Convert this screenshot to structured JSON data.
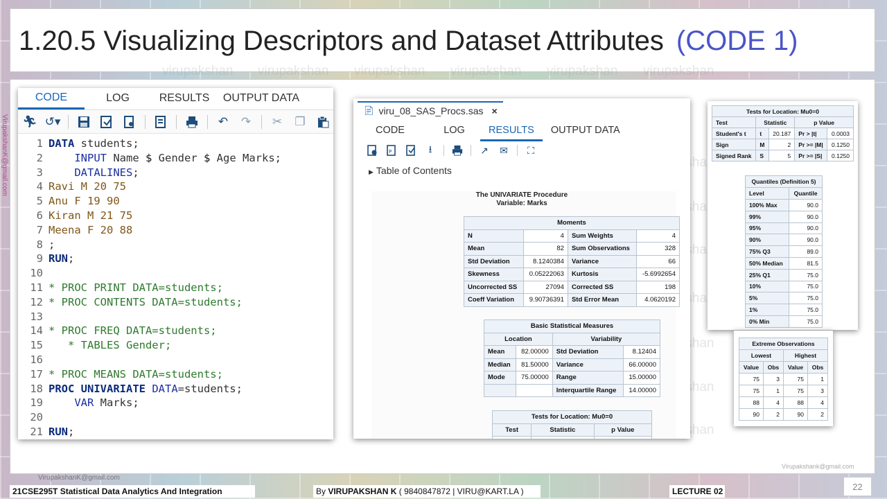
{
  "slide": {
    "title": "1.20.5 Visualizing Descriptors and Dataset Attributes",
    "title_code": "(CODE 1)",
    "watermark": "virupakshan",
    "side_email": "VirupakshanK@gmail.com",
    "footer_email_left": "VirupakshanK@gmail.com",
    "footer_email_right": "Virupakshank@gmail.com",
    "course": "21CSE295T Statistical Data Analytics And Integration",
    "author_prefix": "By ",
    "author_name": "VIRUPAKSHAN K",
    "author_contact": " ( 9840847872 | VIRU@KART.LA )",
    "lecture": "LECTURE 02",
    "page_number": "22",
    "accent_color": "#4a55c6"
  },
  "editor": {
    "tabs": [
      "CODE",
      "LOG",
      "RESULTS",
      "OUTPUT DATA"
    ],
    "active_tab": "CODE",
    "toolbar_icons": [
      "run-icon",
      "history-icon",
      "save-icon",
      "save-as-icon",
      "new-icon",
      "format-icon",
      "print-icon",
      "undo-icon",
      "redo-icon",
      "cut-icon",
      "copy-icon",
      "paste-icon"
    ],
    "lines": [
      {
        "n": "1",
        "parts": [
          [
            "kw",
            "DATA"
          ],
          [
            "tx",
            " students;"
          ]
        ]
      },
      {
        "n": "2",
        "parts": [
          [
            "tx",
            "    "
          ],
          [
            "kw2",
            "INPUT"
          ],
          [
            "tx",
            " Name "
          ],
          [
            "sym",
            "$"
          ],
          [
            "tx",
            " Gender "
          ],
          [
            "sym",
            "$"
          ],
          [
            "tx",
            " Age Marks;"
          ]
        ]
      },
      {
        "n": "3",
        "parts": [
          [
            "tx",
            "    "
          ],
          [
            "kw2",
            "DATALINES"
          ],
          [
            "tx",
            ";"
          ]
        ]
      },
      {
        "n": "4",
        "parts": [
          [
            "dl",
            "Ravi M 20 75"
          ]
        ]
      },
      {
        "n": "5",
        "parts": [
          [
            "dl",
            "Anu F 19 90"
          ]
        ]
      },
      {
        "n": "6",
        "parts": [
          [
            "dl",
            "Kiran M 21 75"
          ]
        ]
      },
      {
        "n": "7",
        "parts": [
          [
            "dl",
            "Meena F 20 88"
          ]
        ]
      },
      {
        "n": "8",
        "parts": [
          [
            "tx",
            ";"
          ]
        ]
      },
      {
        "n": "9",
        "parts": [
          [
            "kw",
            "RUN"
          ],
          [
            "tx",
            ";"
          ]
        ]
      },
      {
        "n": "10",
        "parts": []
      },
      {
        "n": "11",
        "parts": [
          [
            "cm",
            "* PROC PRINT DATA=students;"
          ]
        ]
      },
      {
        "n": "12",
        "parts": [
          [
            "cm",
            "* PROC CONTENTS DATA=students;"
          ]
        ]
      },
      {
        "n": "13",
        "parts": []
      },
      {
        "n": "14",
        "parts": [
          [
            "cm",
            "* PROC FREQ DATA=students;"
          ]
        ]
      },
      {
        "n": "15",
        "parts": [
          [
            "cm",
            "   * TABLES Gender;"
          ]
        ]
      },
      {
        "n": "16",
        "parts": []
      },
      {
        "n": "17",
        "parts": [
          [
            "cm",
            "* PROC MEANS DATA=students;"
          ]
        ]
      },
      {
        "n": "18",
        "parts": [
          [
            "kw",
            "PROC UNIVARIATE"
          ],
          [
            "tx",
            " "
          ],
          [
            "kw2",
            "DATA"
          ],
          [
            "tx",
            "=students;"
          ]
        ]
      },
      {
        "n": "19",
        "parts": [
          [
            "tx",
            "    "
          ],
          [
            "kw2",
            "VAR"
          ],
          [
            "tx",
            " Marks;"
          ]
        ]
      },
      {
        "n": "20",
        "parts": []
      },
      {
        "n": "21",
        "parts": [
          [
            "kw",
            "RUN"
          ],
          [
            "tx",
            ";"
          ]
        ]
      }
    ]
  },
  "results": {
    "file_tab": "viru_08_SAS_Procs.sas",
    "close_label": "×",
    "tabs": [
      "CODE",
      "LOG",
      "RESULTS",
      "OUTPUT DATA"
    ],
    "active_tab": "RESULTS",
    "toolbar_icons": [
      "html-icon",
      "pdf-icon",
      "rtf-icon",
      "download-icon",
      "print-icon",
      "expand-icon",
      "email-icon",
      "fullscreen-icon"
    ],
    "toc_label": "Table of Contents",
    "proc_title": "The UNIVARIATE Procedure",
    "variable_label": "Variable: Marks",
    "moments": {
      "title": "Moments",
      "rows": [
        [
          "N",
          "4",
          "Sum Weights",
          "4"
        ],
        [
          "Mean",
          "82",
          "Sum Observations",
          "328"
        ],
        [
          "Std Deviation",
          "8.1240384",
          "Variance",
          "66"
        ],
        [
          "Skewness",
          "0.05222063",
          "Kurtosis",
          "-5.6992654"
        ],
        [
          "Uncorrected SS",
          "27094",
          "Corrected SS",
          "198"
        ],
        [
          "Coeff Variation",
          "9.90736391",
          "Std Error Mean",
          "4.0620192"
        ]
      ]
    },
    "basic": {
      "title": "Basic Statistical Measures",
      "headers": [
        "Location",
        "Variability"
      ],
      "rows": [
        [
          "Mean",
          "82.00000",
          "Std Deviation",
          "8.12404"
        ],
        [
          "Median",
          "81.50000",
          "Variance",
          "66.00000"
        ],
        [
          "Mode",
          "75.00000",
          "Range",
          "15.00000"
        ],
        [
          "",
          "",
          "Interquartile Range",
          "14.00000"
        ]
      ]
    },
    "tests_partial": {
      "title": "Tests for Location: Mu0=0",
      "headers": [
        "Test",
        "Statistic",
        "p Value"
      ]
    }
  },
  "tests": {
    "title": "Tests for Location: Mu0=0",
    "headers": [
      "Test",
      "Statistic",
      "p Value"
    ],
    "rows": [
      [
        "Student's t",
        "t",
        "20.187",
        "Pr > |t|",
        "0.0003"
      ],
      [
        "Sign",
        "M",
        "2",
        "Pr >= |M|",
        "0.1250"
      ],
      [
        "Signed Rank",
        "S",
        "5",
        "Pr >= |S|",
        "0.1250"
      ]
    ]
  },
  "quantiles": {
    "title": "Quantiles (Definition 5)",
    "headers": [
      "Level",
      "Quantile"
    ],
    "rows": [
      [
        "100% Max",
        "90.0"
      ],
      [
        "99%",
        "90.0"
      ],
      [
        "95%",
        "90.0"
      ],
      [
        "90%",
        "90.0"
      ],
      [
        "75% Q3",
        "89.0"
      ],
      [
        "50% Median",
        "81.5"
      ],
      [
        "25% Q1",
        "75.0"
      ],
      [
        "10%",
        "75.0"
      ],
      [
        "5%",
        "75.0"
      ],
      [
        "1%",
        "75.0"
      ],
      [
        "0% Min",
        "75.0"
      ]
    ]
  },
  "extreme": {
    "title": "Extreme Observations",
    "groups": [
      "Lowest",
      "Highest"
    ],
    "headers": [
      "Value",
      "Obs",
      "Value",
      "Obs"
    ],
    "rows": [
      [
        "75",
        "3",
        "75",
        "1"
      ],
      [
        "75",
        "1",
        "75",
        "3"
      ],
      [
        "88",
        "4",
        "88",
        "4"
      ],
      [
        "90",
        "2",
        "90",
        "2"
      ]
    ]
  }
}
